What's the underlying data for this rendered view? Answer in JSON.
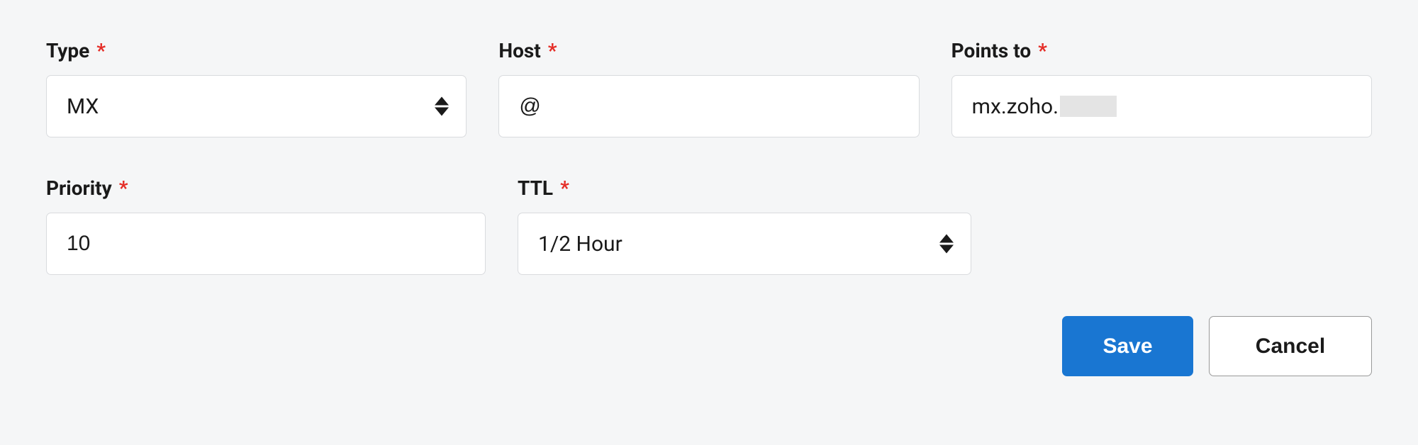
{
  "fields": {
    "type": {
      "label": "Type",
      "required": true,
      "value": "MX"
    },
    "host": {
      "label": "Host",
      "required": true,
      "value": "@"
    },
    "points_to": {
      "label": "Points to",
      "required": true,
      "value": "mx.zoho."
    },
    "priority": {
      "label": "Priority",
      "required": true,
      "value": "10"
    },
    "ttl": {
      "label": "TTL",
      "required": true,
      "value": "1/2 Hour"
    }
  },
  "required_mark": "*",
  "buttons": {
    "save": "Save",
    "cancel": "Cancel"
  }
}
